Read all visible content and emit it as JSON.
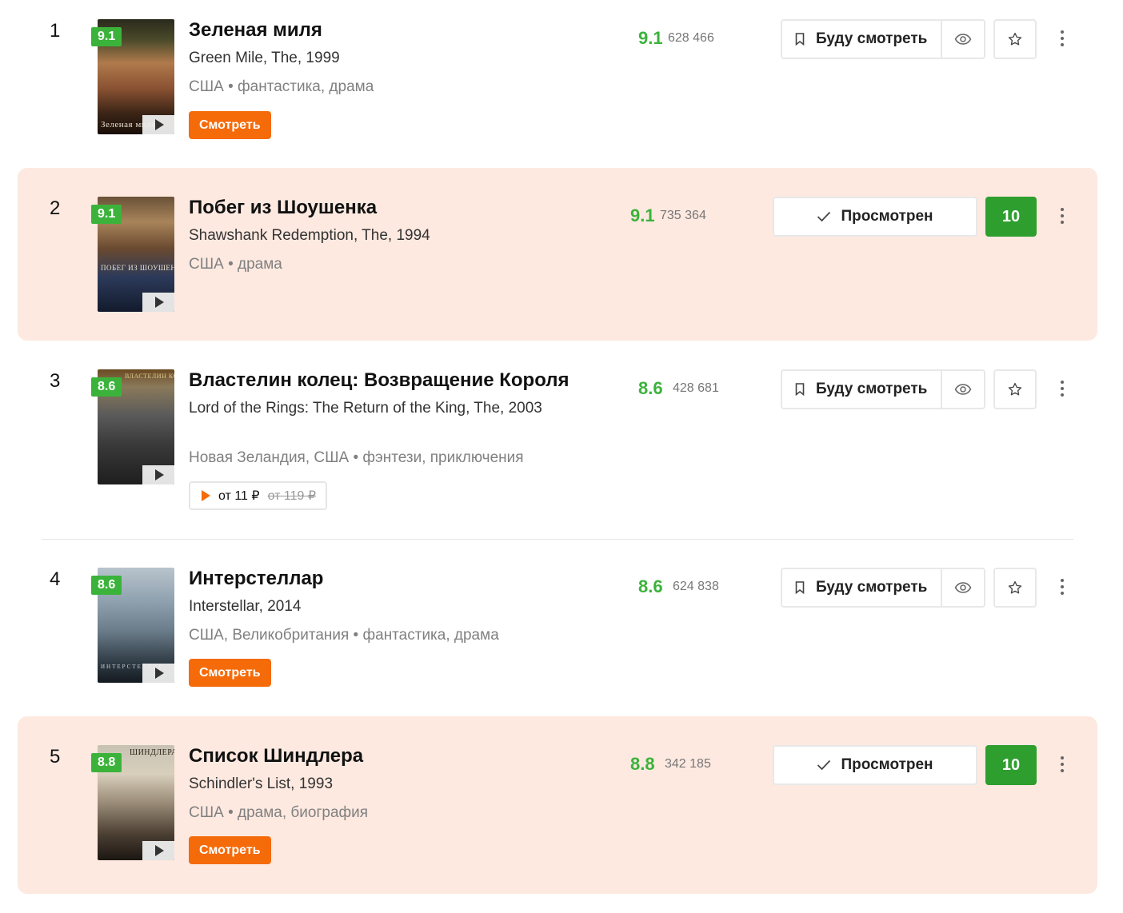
{
  "films": [
    {
      "rank": "1",
      "badge": "9.1",
      "title": "Зеленая миля",
      "original": "Green Mile, The, 1999",
      "meta": "США • фантастика, драма",
      "action_label": "Смотреть",
      "poster_text": "Зеленая миля",
      "score": "9.1",
      "votes": "628 466",
      "state": "will_watch",
      "will_watch_label": "Буду смотреть",
      "highlighted": false
    },
    {
      "rank": "2",
      "badge": "9.1",
      "title": "Побег из Шоушенка",
      "original": "Shawshank Redemption, The, 1994",
      "meta": "США • драма",
      "poster_text": "ПОБЕГ ИЗ ШОУШЕНКА",
      "score": "9.1",
      "votes": "735 364",
      "state": "watched",
      "watched_label": "Просмотрен",
      "my_rating": "10",
      "highlighted": true
    },
    {
      "rank": "3",
      "badge": "8.6",
      "title": "Властелин колец: Возвращение Короля",
      "original": "Lord of the Rings: The Return of the King, The, 2003",
      "meta": "Новая Зеландия, США • фэнтези, приключения",
      "price_from": "от 11 ₽",
      "price_old": "от 119 ₽",
      "poster_text": "ВЛАСТЕЛИН КОЛЕЦ",
      "score": "8.6",
      "votes": "428 681",
      "state": "will_watch",
      "will_watch_label": "Буду смотреть",
      "highlighted": false
    },
    {
      "rank": "4",
      "badge": "8.6",
      "title": "Интерстеллар",
      "original": "Interstellar, 2014",
      "meta": "США, Великобритания • фантастика, драма",
      "action_label": "Смотреть",
      "poster_text": "ИНТЕРСТЕЛЛАР",
      "score": "8.6",
      "votes": "624 838",
      "state": "will_watch",
      "will_watch_label": "Буду смотреть",
      "highlighted": false
    },
    {
      "rank": "5",
      "badge": "8.8",
      "title": "Список Шиндлера",
      "original": "Schindler's List, 1993",
      "meta": "США • драма, биография",
      "action_label": "Смотреть",
      "poster_text": "ШИНДЛЕРА",
      "score": "8.8",
      "votes": "342 185",
      "state": "watched",
      "watched_label": "Просмотрен",
      "my_rating": "10",
      "highlighted": true
    }
  ],
  "colors": {
    "rating_green": "#3bb33b",
    "my_rating_green": "#2e9e2e",
    "watch_orange": "#f56b0a",
    "highlight_bg": "#fde9e0"
  },
  "icons": [
    "bookmark-icon",
    "eye-icon",
    "star-icon",
    "check-icon",
    "more-icon",
    "play-icon"
  ]
}
